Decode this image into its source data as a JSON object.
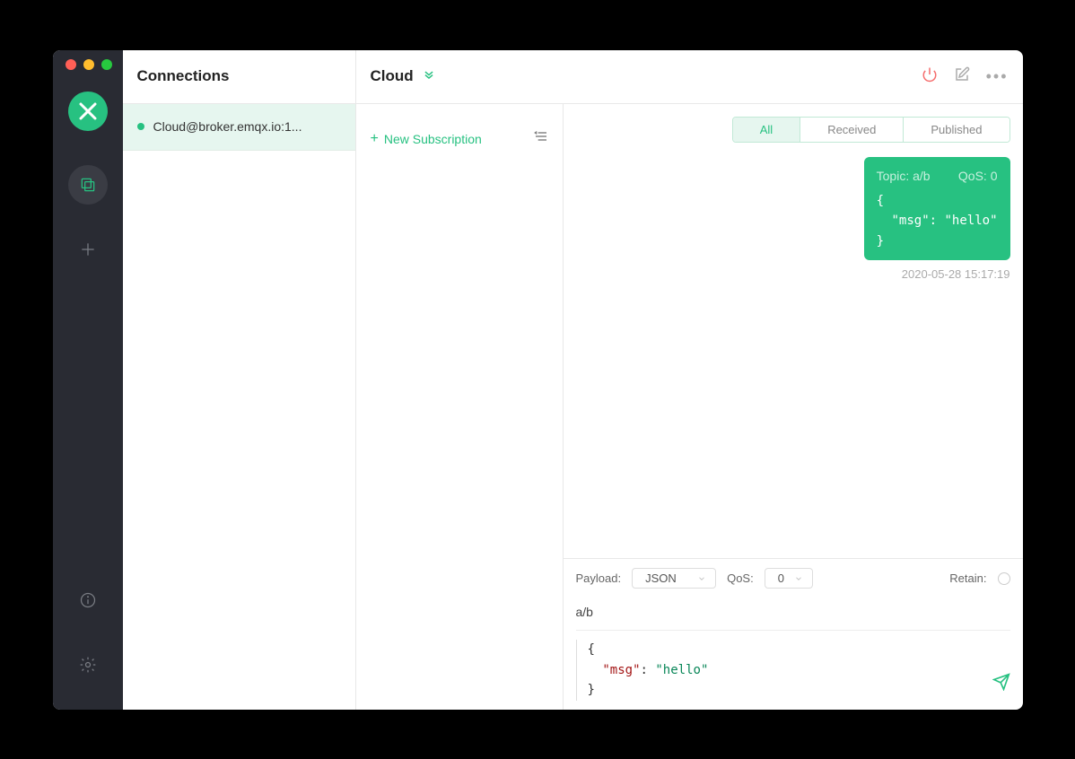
{
  "sidebar": {
    "title": "Connections",
    "items": [
      {
        "name": "Cloud@broker.emqx.io:1...",
        "online": true
      }
    ]
  },
  "header": {
    "connectionName": "Cloud"
  },
  "subscription": {
    "newButton": "New Subscription"
  },
  "filterTabs": {
    "all": "All",
    "received": "Received",
    "published": "Published"
  },
  "messages": [
    {
      "topicLabel": "Topic: a/b",
      "qosLabel": "QoS: 0",
      "payload": "{\n  \"msg\": \"hello\"\n}",
      "time": "2020-05-28 15:17:19"
    }
  ],
  "publisher": {
    "payloadLabel": "Payload:",
    "payloadType": "JSON",
    "qosLabel": "QoS:",
    "qosValue": "0",
    "retainLabel": "Retain:",
    "topic": "a/b",
    "bodyPrefix": "{\n  ",
    "bodyKey": "\"msg\"",
    "bodyColon": ": ",
    "bodyValue": "\"hello\"",
    "bodySuffix": "\n}"
  }
}
